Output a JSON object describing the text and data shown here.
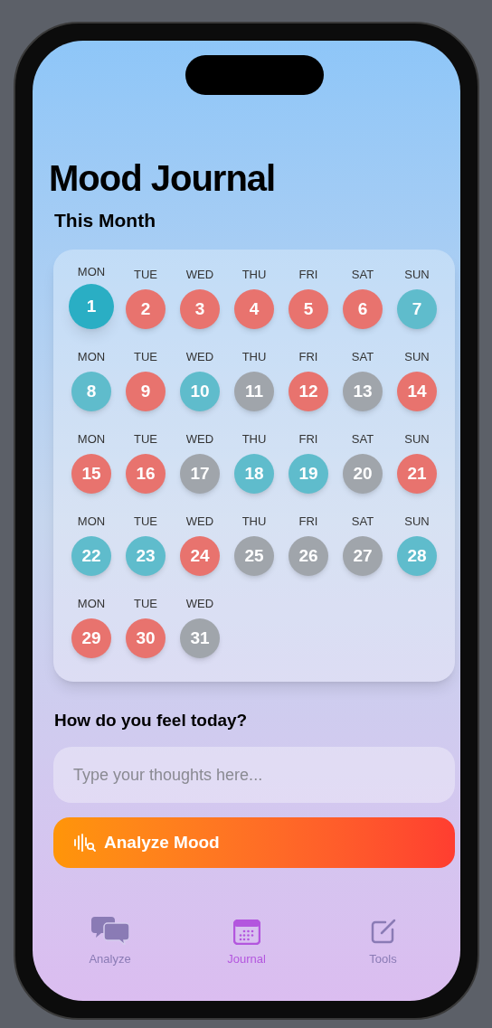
{
  "title": "Mood Journal",
  "calendar": {
    "heading": "This Month",
    "days": [
      {
        "weekday": "MON",
        "day": "1",
        "color": "#2aaec4",
        "selected": true
      },
      {
        "weekday": "TUE",
        "day": "2",
        "color": "#e8736e",
        "selected": false
      },
      {
        "weekday": "WED",
        "day": "3",
        "color": "#e8736e",
        "selected": false
      },
      {
        "weekday": "THU",
        "day": "4",
        "color": "#e8736e",
        "selected": false
      },
      {
        "weekday": "FRI",
        "day": "5",
        "color": "#e8736e",
        "selected": false
      },
      {
        "weekday": "SAT",
        "day": "6",
        "color": "#e8736e",
        "selected": false
      },
      {
        "weekday": "SUN",
        "day": "7",
        "color": "#5fbccc",
        "selected": false
      },
      {
        "weekday": "MON",
        "day": "8",
        "color": "#5fbccc",
        "selected": false
      },
      {
        "weekday": "TUE",
        "day": "9",
        "color": "#e8736e",
        "selected": false
      },
      {
        "weekday": "WED",
        "day": "10",
        "color": "#5fbccc",
        "selected": false
      },
      {
        "weekday": "THU",
        "day": "11",
        "color": "#a0a5ab",
        "selected": false
      },
      {
        "weekday": "FRI",
        "day": "12",
        "color": "#e8736e",
        "selected": false
      },
      {
        "weekday": "SAT",
        "day": "13",
        "color": "#a0a5ab",
        "selected": false
      },
      {
        "weekday": "SUN",
        "day": "14",
        "color": "#e8736e",
        "selected": false
      },
      {
        "weekday": "MON",
        "day": "15",
        "color": "#e8736e",
        "selected": false
      },
      {
        "weekday": "TUE",
        "day": "16",
        "color": "#e8736e",
        "selected": false
      },
      {
        "weekday": "WED",
        "day": "17",
        "color": "#a0a5ab",
        "selected": false
      },
      {
        "weekday": "THU",
        "day": "18",
        "color": "#5fbccc",
        "selected": false
      },
      {
        "weekday": "FRI",
        "day": "19",
        "color": "#5fbccc",
        "selected": false
      },
      {
        "weekday": "SAT",
        "day": "20",
        "color": "#a0a5ab",
        "selected": false
      },
      {
        "weekday": "SUN",
        "day": "21",
        "color": "#e8736e",
        "selected": false
      },
      {
        "weekday": "MON",
        "day": "22",
        "color": "#5fbccc",
        "selected": false
      },
      {
        "weekday": "TUE",
        "day": "23",
        "color": "#5fbccc",
        "selected": false
      },
      {
        "weekday": "WED",
        "day": "24",
        "color": "#e8736e",
        "selected": false
      },
      {
        "weekday": "THU",
        "day": "25",
        "color": "#a0a5ab",
        "selected": false
      },
      {
        "weekday": "FRI",
        "day": "26",
        "color": "#a0a5ab",
        "selected": false
      },
      {
        "weekday": "SAT",
        "day": "27",
        "color": "#a0a5ab",
        "selected": false
      },
      {
        "weekday": "SUN",
        "day": "28",
        "color": "#5fbccc",
        "selected": false
      },
      {
        "weekday": "MON",
        "day": "29",
        "color": "#e8736e",
        "selected": false
      },
      {
        "weekday": "TUE",
        "day": "30",
        "color": "#e8736e",
        "selected": false
      },
      {
        "weekday": "WED",
        "day": "31",
        "color": "#a0a5ab",
        "selected": false
      }
    ]
  },
  "prompt": "How do you feel today?",
  "thoughts": {
    "placeholder": "Type your thoughts here..."
  },
  "analyze_button": "Analyze Mood",
  "tabs": [
    {
      "label": "Analyze",
      "selected": false
    },
    {
      "label": "Journal",
      "selected": true
    },
    {
      "label": "Tools",
      "selected": false
    }
  ]
}
